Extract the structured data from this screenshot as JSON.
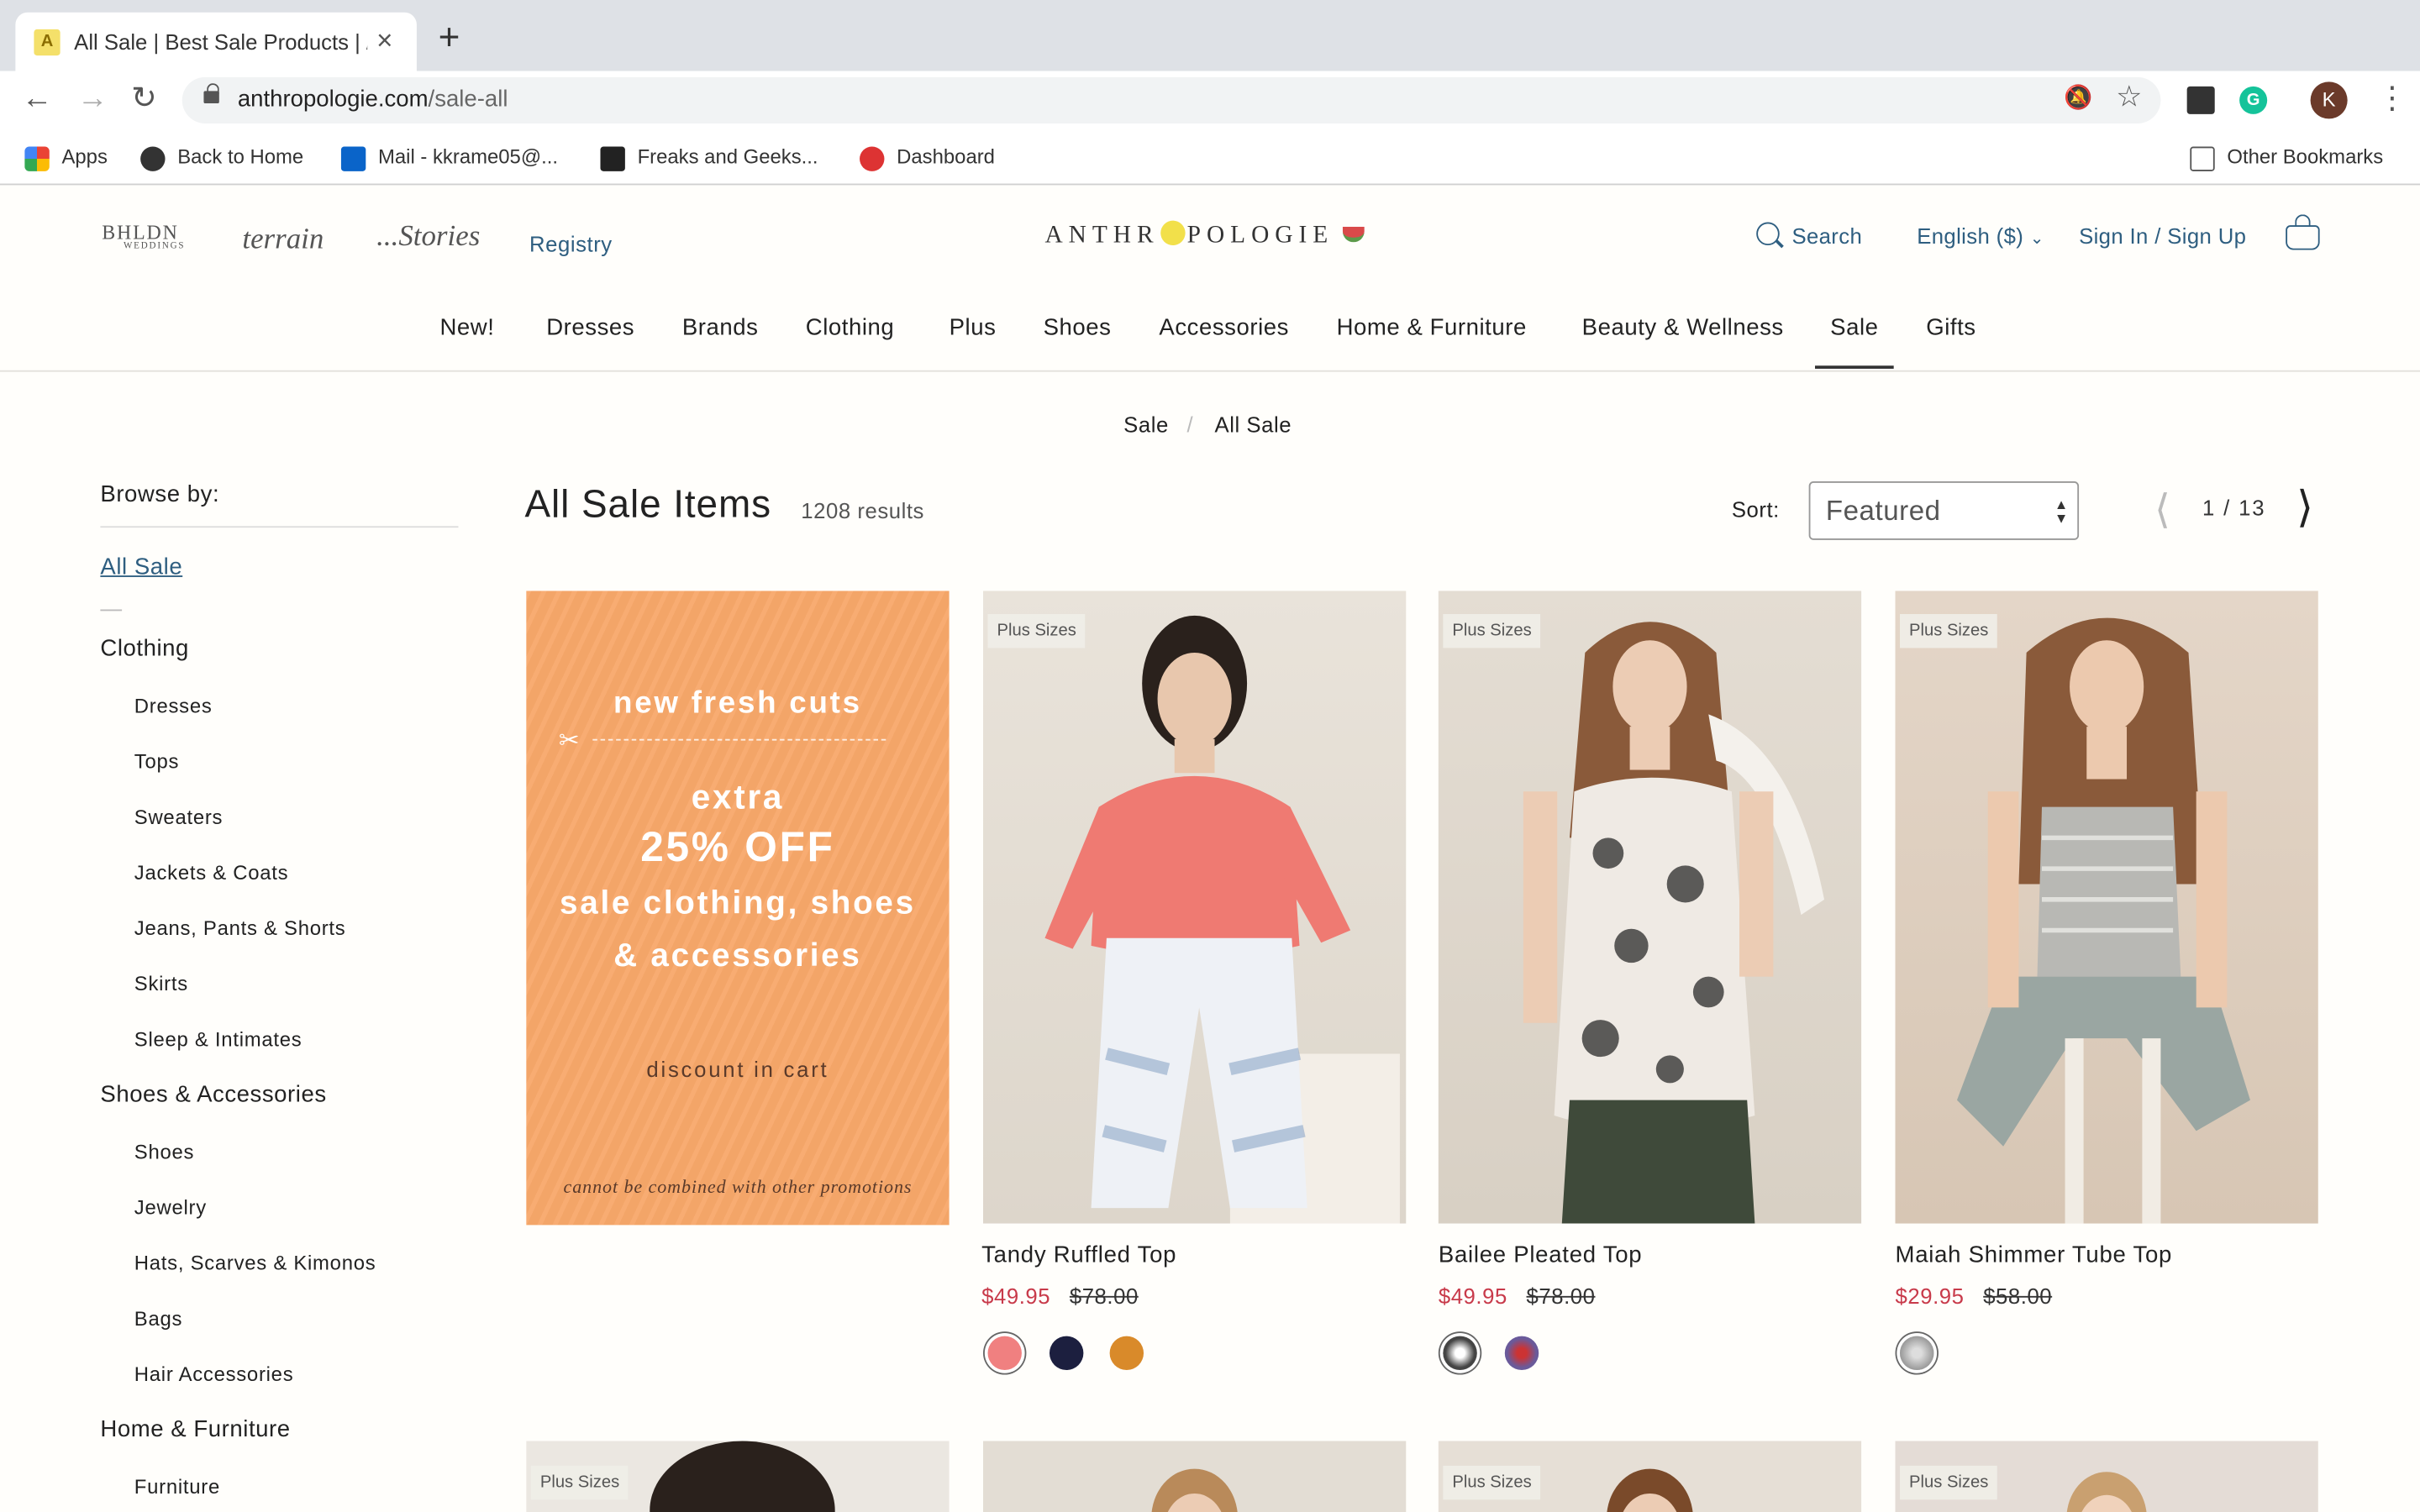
{
  "browser": {
    "tab_title": "All Sale | Best Sale Products | /",
    "tab_close": "×",
    "new_tab": "+",
    "url_domain": "anthropologie.com",
    "url_path": "/sale-all",
    "avatar_initial": "K",
    "bookmarks": [
      "Apps",
      "Back to Home",
      "Mail - kkrame05@...",
      "Freaks and Geeks...",
      "Dashboard"
    ],
    "other_bookmarks": "Other Bookmarks"
  },
  "header": {
    "bhldn": "BHLDN",
    "bhldn_sub": "WEDDINGS",
    "terrain": "terrain",
    "stories": "...Stories",
    "registry": "Registry",
    "logo_left": "ANTHR",
    "logo_right": "POLOGIE",
    "search": "Search",
    "language": "English ($)",
    "sign_in": "Sign In / Sign Up"
  },
  "nav": [
    "New!",
    "Dresses",
    "Brands",
    "Clothing",
    "Plus",
    "Shoes",
    "Accessories",
    "Home & Furniture",
    "Beauty & Wellness",
    "Sale",
    "Gifts"
  ],
  "breadcrumb": {
    "first": "Sale",
    "sep": "/",
    "current": "All Sale"
  },
  "sidebar": {
    "browse_by": "Browse by:",
    "all_sale": "All Sale",
    "clothing": {
      "label": "Clothing",
      "items": [
        "Dresses",
        "Tops",
        "Sweaters",
        "Jackets & Coats",
        "Jeans, Pants & Shorts",
        "Skirts",
        "Sleep & Intimates"
      ]
    },
    "shoes_acc": {
      "label": "Shoes & Accessories",
      "items": [
        "Shoes",
        "Jewelry",
        "Hats, Scarves & Kimonos",
        "Bags",
        "Hair Accessories"
      ]
    },
    "home": {
      "label": "Home & Furniture",
      "items": [
        "Furniture"
      ]
    }
  },
  "listing": {
    "title": "All Sale Items",
    "count": "1208 results",
    "sort_label": "Sort:",
    "sort_value": "Featured",
    "page": "1 / 13"
  },
  "promo": {
    "line1": "new fresh cuts",
    "line2": "extra",
    "line3": "25% OFF",
    "line4": "sale clothing, shoes",
    "line5": "& accessories",
    "line6": "discount in cart",
    "footnote": "cannot be combined with other promotions"
  },
  "products": [
    {
      "badge": "Plus Sizes",
      "name": "Tandy Ruffled Top",
      "sale": "$49.95",
      "orig": "$78.00",
      "swatches": [
        "#f08080",
        "#1c1f3f",
        "#d98a2a"
      ]
    },
    {
      "badge": "Plus Sizes",
      "name": "Bailee Pleated Top",
      "sale": "$49.95",
      "orig": "$78.00",
      "swatches": [
        "#555555",
        "#8a6a9a"
      ]
    },
    {
      "badge": "Plus Sizes",
      "name": "Maiah Shimmer Tube Top",
      "sale": "$29.95",
      "orig": "$58.00",
      "swatches": [
        "#b0b0b0"
      ]
    }
  ],
  "row2_badges": [
    "Plus Sizes",
    "Plus Sizes",
    "Plus Sizes"
  ]
}
